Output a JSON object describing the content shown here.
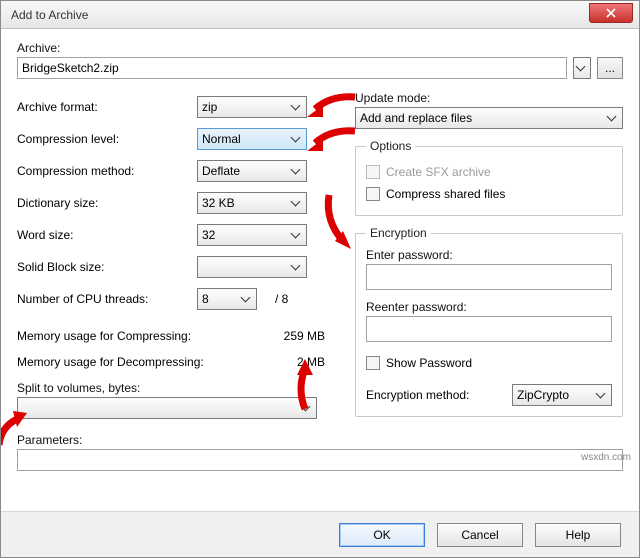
{
  "window": {
    "title": "Add to Archive"
  },
  "archive": {
    "label": "Archive:",
    "value": "BridgeSketch2.zip",
    "browse": "..."
  },
  "left": {
    "archive_format": {
      "label": "Archive format:",
      "value": "zip"
    },
    "compression_level": {
      "label": "Compression level:",
      "value": "Normal"
    },
    "compression_method": {
      "label": "Compression method:",
      "value": "Deflate"
    },
    "dictionary_size": {
      "label": "Dictionary size:",
      "value": "32 KB"
    },
    "word_size": {
      "label": "Word size:",
      "value": "32"
    },
    "solid_block": {
      "label": "Solid Block size:",
      "value": ""
    },
    "cpu_threads": {
      "label": "Number of CPU threads:",
      "value": "8",
      "suffix": "/ 8"
    },
    "mem_compress": {
      "label": "Memory usage for Compressing:",
      "value": "259 MB"
    },
    "mem_decompress": {
      "label": "Memory usage for Decompressing:",
      "value": "2 MB"
    },
    "split": {
      "label": "Split to volumes, bytes:",
      "value": ""
    },
    "parameters": {
      "label": "Parameters:",
      "value": ""
    }
  },
  "right": {
    "update_mode": {
      "label": "Update mode:",
      "value": "Add and replace files"
    },
    "options": {
      "legend": "Options",
      "create_sfx": {
        "label": "Create SFX archive",
        "checked": false,
        "disabled": true
      },
      "compress_shared": {
        "label": "Compress shared files",
        "checked": false,
        "disabled": false
      }
    },
    "encryption": {
      "legend": "Encryption",
      "enter_label": "Enter password:",
      "reenter_label": "Reenter password:",
      "show_password": {
        "label": "Show Password",
        "checked": false
      },
      "method": {
        "label": "Encryption method:",
        "value": "ZipCrypto"
      }
    }
  },
  "buttons": {
    "ok": "OK",
    "cancel": "Cancel",
    "help": "Help"
  },
  "watermark": "wsxdn.com"
}
